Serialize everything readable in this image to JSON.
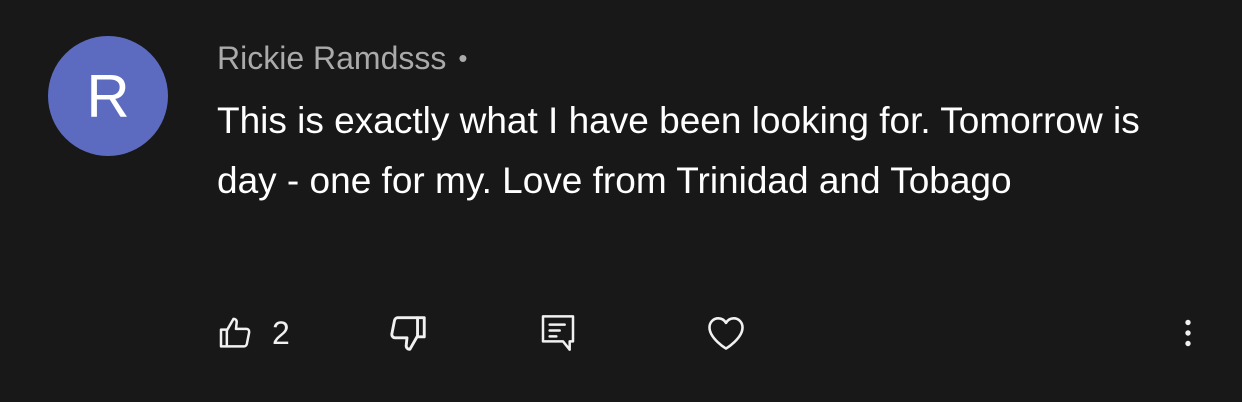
{
  "comment": {
    "avatar_letter": "R",
    "avatar_color": "#5c6bc0",
    "author": "Rickie Ramdsss",
    "separator": "•",
    "text": "This is exactly what I have been looking for. Tomorrow is day - one for my. Love from Trinidad and Tobago"
  },
  "actions": {
    "like_icon": "thumbs-up-icon",
    "like_count": "2",
    "dislike_icon": "thumbs-down-icon",
    "reply_icon": "comment-icon",
    "heart_icon": "heart-icon",
    "more_icon": "more-vertical-icon"
  },
  "colors": {
    "background": "#181818",
    "text": "#ffffff",
    "muted": "#aaaaaa"
  }
}
